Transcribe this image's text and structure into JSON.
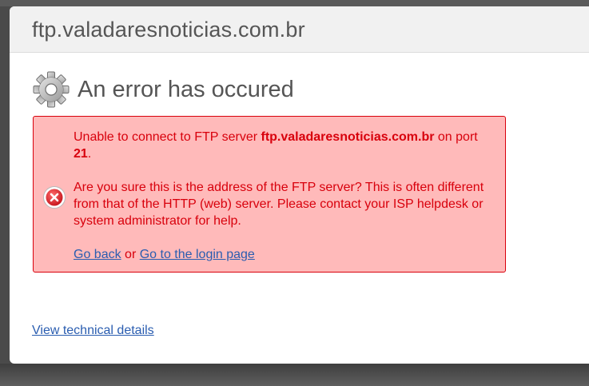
{
  "header": {
    "host": "ftp.valadaresnoticias.com.br"
  },
  "error": {
    "title": "An error has occured",
    "icon": "gear-icon",
    "status_icon": "error-x-icon",
    "colors": {
      "box_bg": "#ffbaba",
      "box_border": "#d8000c",
      "text": "#d8000c",
      "link": "#2a5db0"
    },
    "line1_prefix": "Unable to connect to FTP server ",
    "server": "ftp.valadaresnoticias.com.br",
    "line1_mid": " on port ",
    "port": "21",
    "line1_suffix": ".",
    "para2": "Are you sure this is the address of the FTP server? This is often different from that of the HTTP (web) server. Please contact your ISP helpdesk or system administrator for help.",
    "go_back_label": "Go back",
    "or_text": " or ",
    "login_label": "Go to the login page"
  },
  "footer": {
    "technical_details_label": "View technical details"
  }
}
